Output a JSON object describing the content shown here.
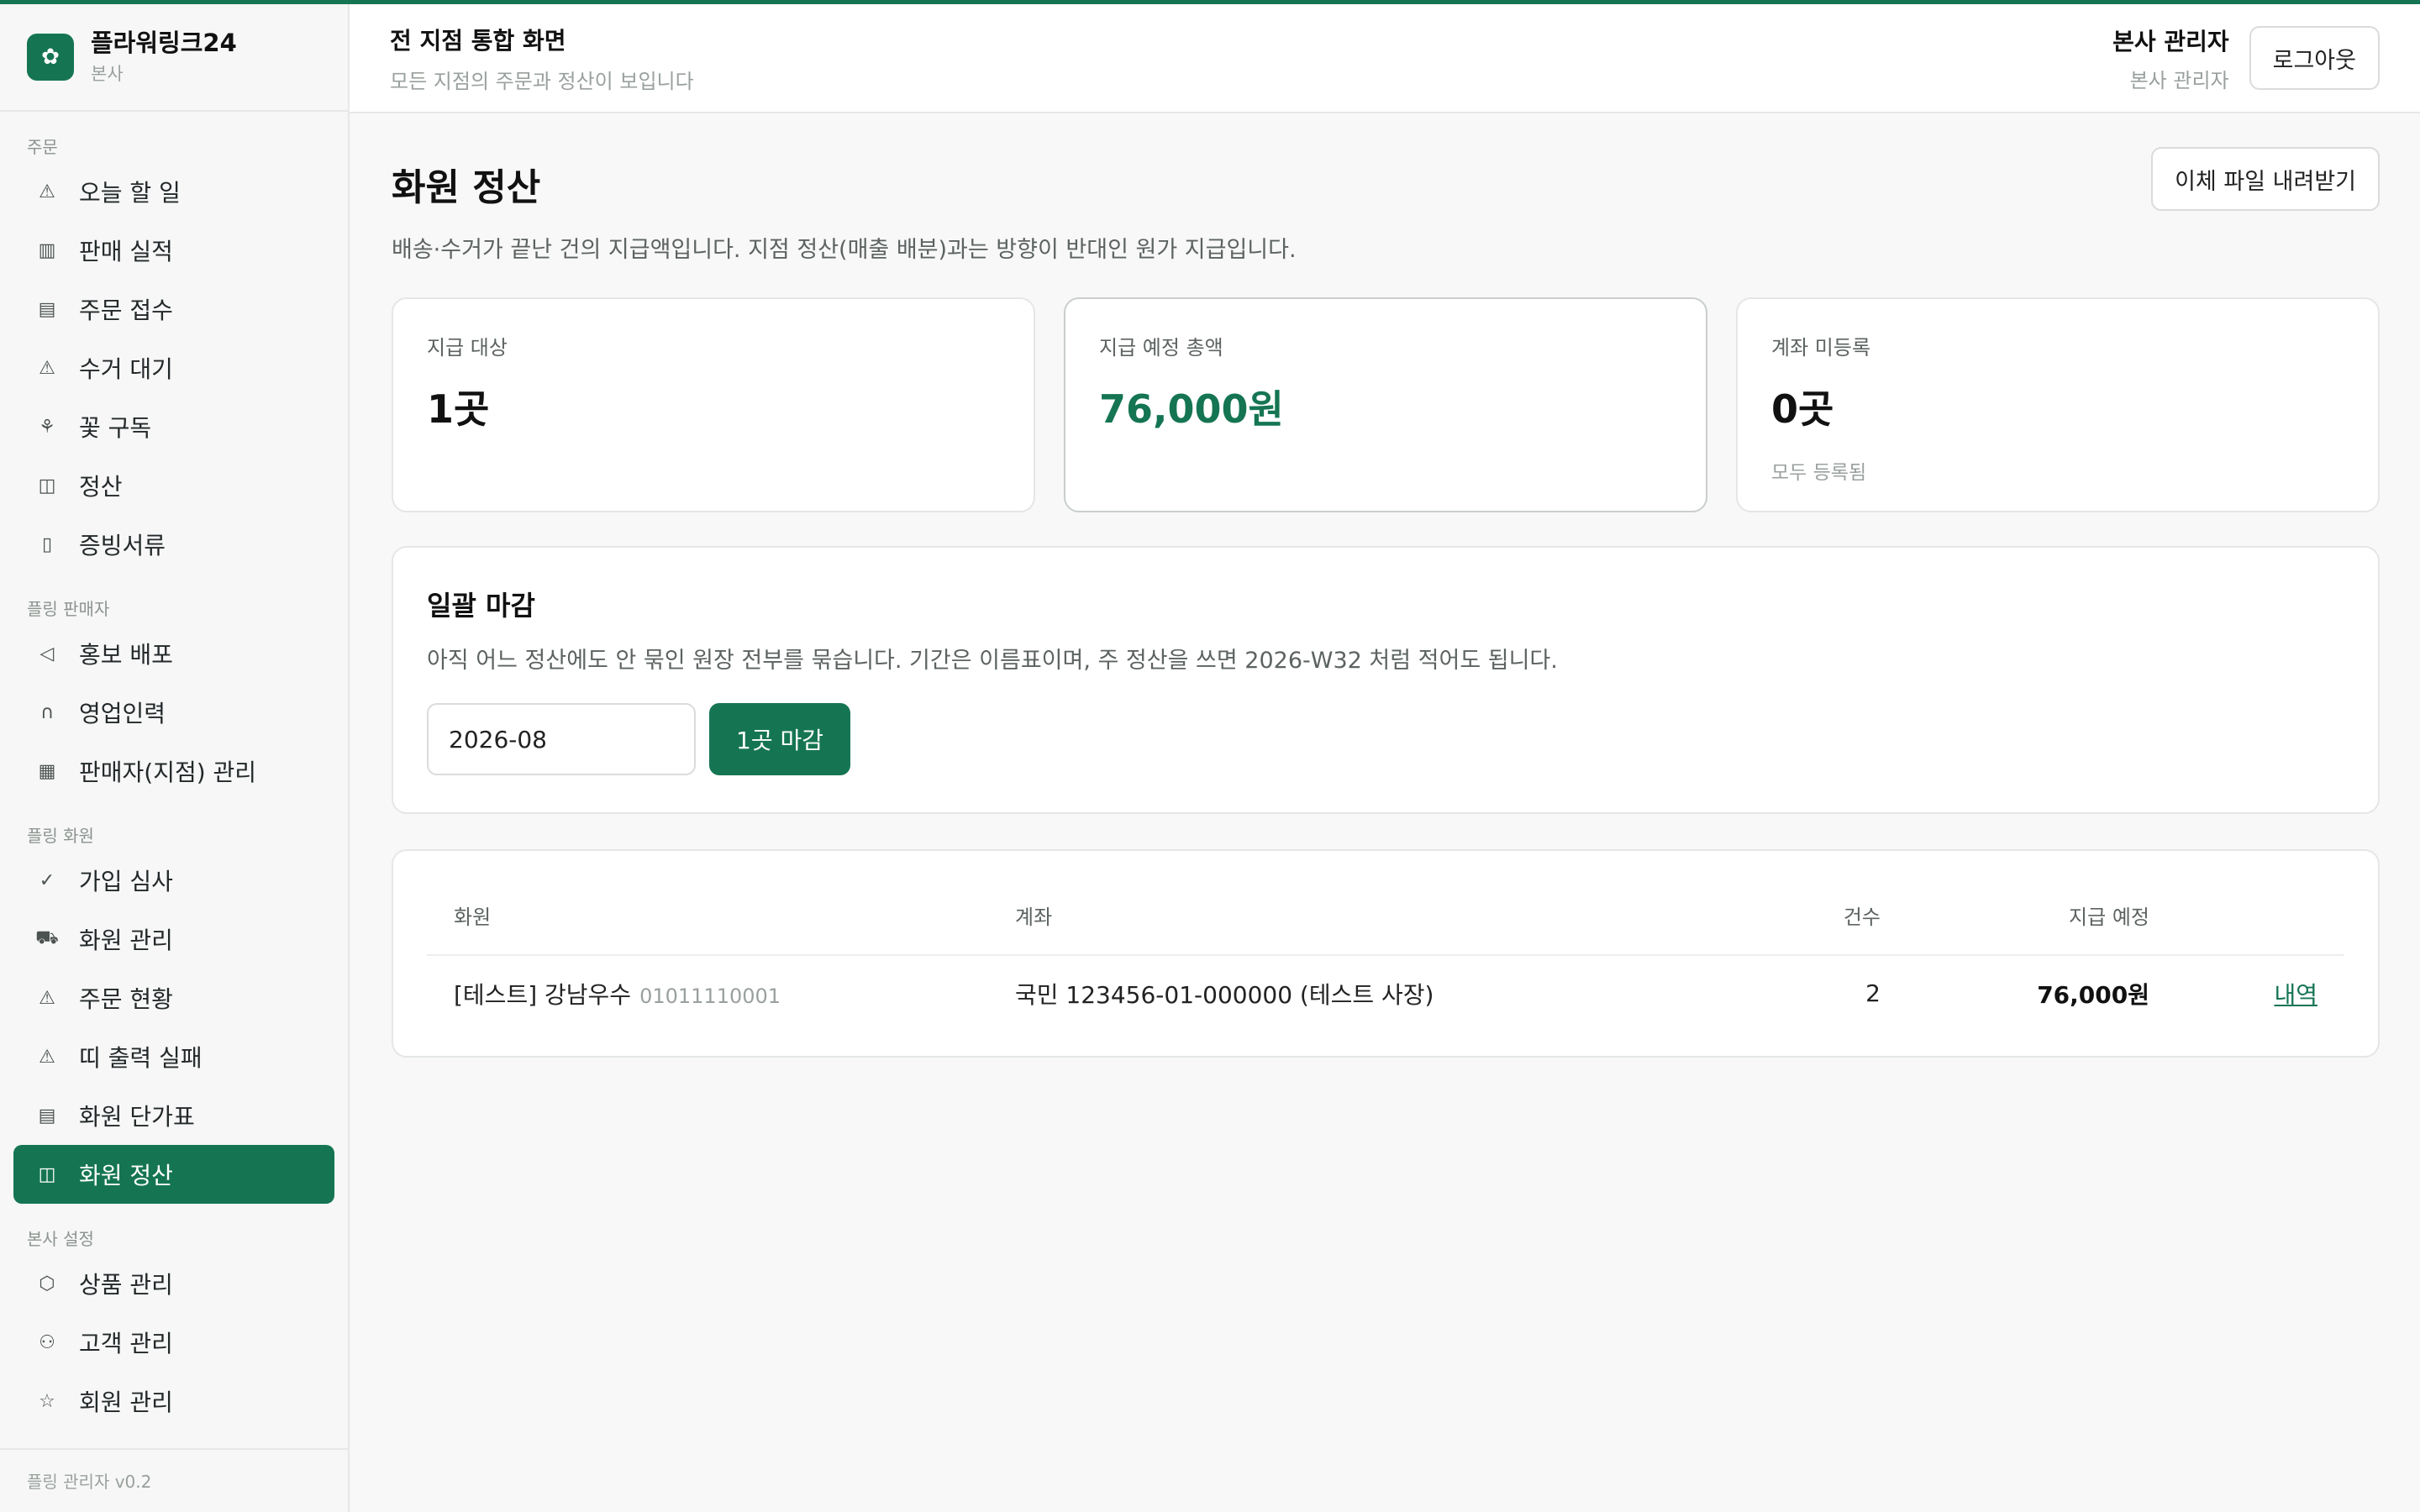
{
  "brand": {
    "name": "플라워링크24",
    "sub": "본사"
  },
  "sidebar": {
    "sections": [
      {
        "label": "주문",
        "items": [
          {
            "label": "오늘 할 일",
            "icon": "warning-icon"
          },
          {
            "label": "판매 실적",
            "icon": "bar-chart-icon"
          },
          {
            "label": "주문 접수",
            "icon": "receipt-icon"
          },
          {
            "label": "수거 대기",
            "icon": "warning-icon"
          },
          {
            "label": "꽃 구독",
            "icon": "flower-icon"
          },
          {
            "label": "정산",
            "icon": "wallet-icon"
          },
          {
            "label": "증빙서류",
            "icon": "document-icon"
          }
        ]
      },
      {
        "label": "플링 판매자",
        "items": [
          {
            "label": "홍보 배포",
            "icon": "megaphone-icon"
          },
          {
            "label": "영업인력",
            "icon": "headset-icon"
          },
          {
            "label": "판매자(지점) 관리",
            "icon": "store-icon"
          }
        ]
      },
      {
        "label": "플링 화원",
        "items": [
          {
            "label": "가입 심사",
            "icon": "check-icon"
          },
          {
            "label": "화원 관리",
            "icon": "truck-icon"
          },
          {
            "label": "주문 현황",
            "icon": "warning-icon"
          },
          {
            "label": "띠 출력 실패",
            "icon": "warning-icon"
          },
          {
            "label": "화원 단가표",
            "icon": "receipt-icon"
          },
          {
            "label": "화원 정산",
            "icon": "wallet-icon",
            "active": true
          }
        ]
      },
      {
        "label": "본사 설정",
        "items": [
          {
            "label": "상품 관리",
            "icon": "box-icon"
          },
          {
            "label": "고객 관리",
            "icon": "user-icon"
          },
          {
            "label": "회원 관리",
            "icon": "star-icon"
          }
        ]
      }
    ],
    "footer": "플링 관리자 v0.2"
  },
  "header": {
    "title": "전 지점 통합 화면",
    "subtitle": "모든 지점의 주문과 정산이 보입니다",
    "user_name": "본사 관리자",
    "user_role": "본사 관리자",
    "logout": "로그아웃"
  },
  "page": {
    "title": "화원 정산",
    "description": "배송·수거가 끝난 건의 지급액입니다. 지점 정산(매출 배분)과는 방향이 반대인 원가 지급입니다.",
    "download_button": "이체 파일 내려받기"
  },
  "cards": [
    {
      "label": "지급 대상",
      "value": "1곳",
      "note": ""
    },
    {
      "label": "지급 예정 총액",
      "value": "76,000원",
      "note": ""
    },
    {
      "label": "계좌 미등록",
      "value": "0곳",
      "note": "모두 등록됨"
    }
  ],
  "batch": {
    "title": "일괄 마감",
    "description": "아직 어느 정산에도 안 묶인 원장 전부를 묶습니다. 기간은 이름표이며, 주 정산을 쓰면 2026-W32 처럼 적어도 됩니다.",
    "period_value": "2026-08",
    "button": "1곳 마감"
  },
  "table": {
    "headers": [
      "화원",
      "계좌",
      "건수",
      "지급 예정",
      ""
    ],
    "rows": [
      {
        "member": "[테스트] 강남우수",
        "member_id": "01011110001",
        "account": "국민 123456-01-000000 (테스트 사장)",
        "count": "2",
        "amount": "76,000원",
        "link": "내역"
      }
    ]
  },
  "colors": {
    "accent": "#157553"
  }
}
